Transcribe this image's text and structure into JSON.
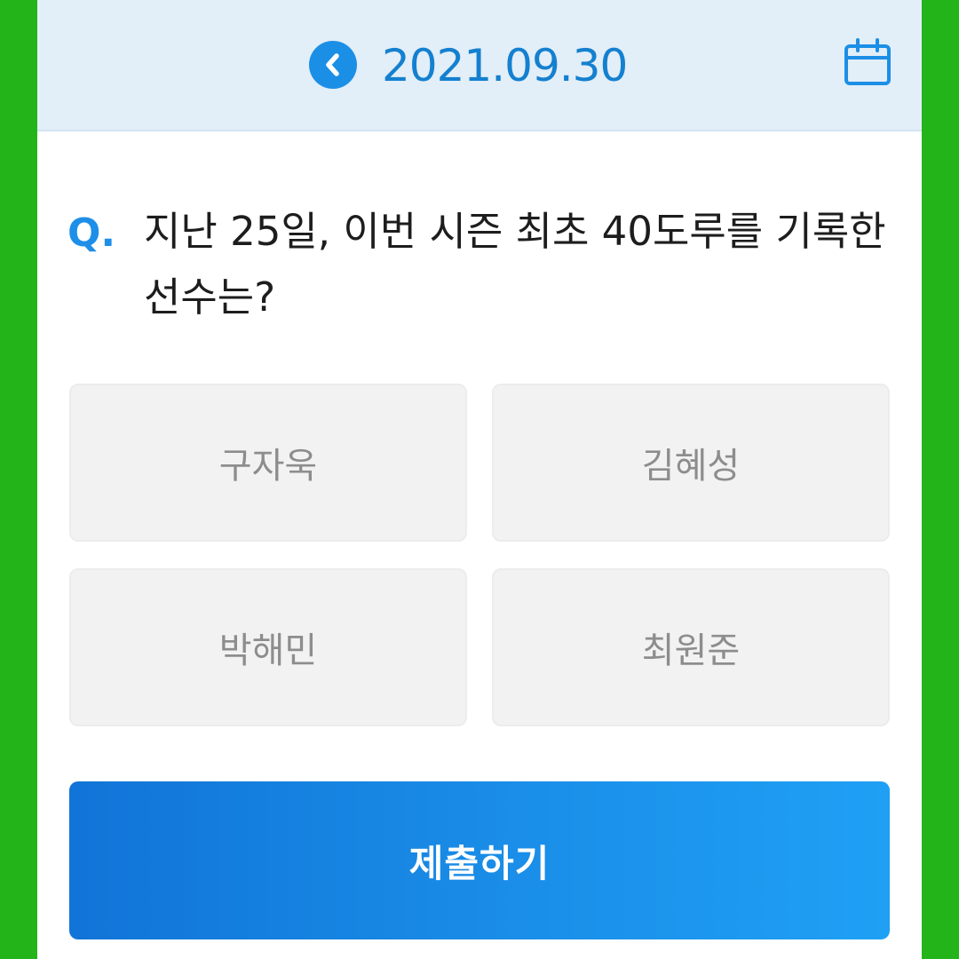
{
  "colors": {
    "outer_frame": "#22b419",
    "header_bg": "#e2eef8",
    "accent": "#1b8fe6",
    "option_bg": "#f2f2f2",
    "option_text": "#8d8d8d"
  },
  "header": {
    "prev_icon": "chevron-left-icon",
    "date": "2021.09.30",
    "calendar_icon": "calendar-icon"
  },
  "question": {
    "marker": "Q.",
    "text": "지난 25일, 이번 시즌 최초 40도루를 기록한 선수는?"
  },
  "options": [
    {
      "label": "구자욱"
    },
    {
      "label": "김혜성"
    },
    {
      "label": "박해민"
    },
    {
      "label": "최원준"
    }
  ],
  "submit": {
    "label": "제출하기"
  }
}
